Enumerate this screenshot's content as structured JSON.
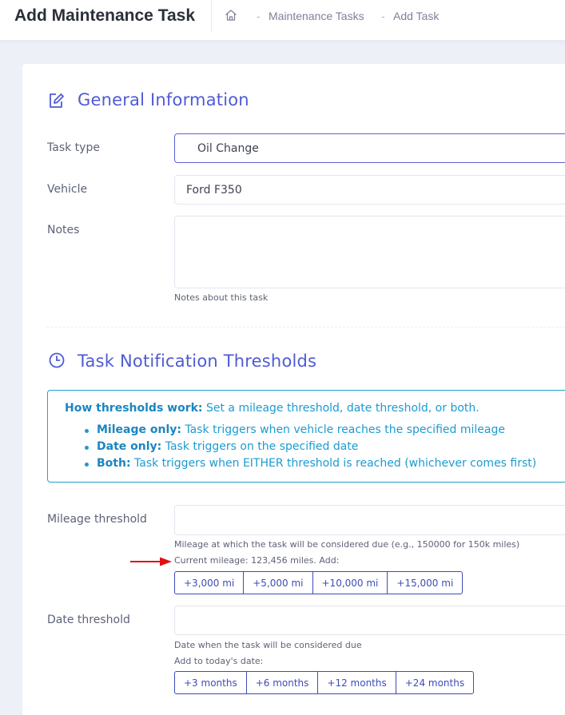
{
  "header": {
    "title": "Add Maintenance Task",
    "breadcrumb": [
      {
        "label": "Maintenance Tasks"
      },
      {
        "label": "Add Task"
      }
    ],
    "separator": "-"
  },
  "general": {
    "title": "General Information",
    "task_type": {
      "label": "Task type",
      "value": "Oil Change"
    },
    "vehicle": {
      "label": "Vehicle",
      "value": "Ford F350"
    },
    "notes": {
      "label": "Notes",
      "value": "",
      "help": "Notes about this task"
    }
  },
  "thresholds": {
    "title": "Task Notification Thresholds",
    "info": {
      "intro_bold": "How thresholds work:",
      "intro_text": "Set a mileage threshold, date threshold, or both.",
      "items": [
        {
          "bold": "Mileage only:",
          "text": "Task triggers when vehicle reaches the specified mileage"
        },
        {
          "bold": "Date only:",
          "text": "Task triggers on the specified date"
        },
        {
          "bold": "Both:",
          "text": "Task triggers when EITHER threshold is reached (whichever comes first)"
        }
      ]
    },
    "mileage": {
      "label": "Mileage threshold",
      "value": "",
      "help": "Mileage at which the task will be considered due (e.g., 150000 for 150k miles)",
      "current": "Current mileage: 123,456 miles. Add:",
      "buttons": [
        "+3,000 mi",
        "+5,000 mi",
        "+10,000 mi",
        "+15,000 mi"
      ]
    },
    "date": {
      "label": "Date threshold",
      "value": "",
      "help": "Date when the task will be considered due",
      "add_label": "Add to today's date:",
      "buttons": [
        "+3 months",
        "+6 months",
        "+12 months",
        "+24 months"
      ]
    }
  },
  "colors": {
    "accent": "#4f5bd5",
    "info": "#1c9bd0",
    "button_border": "#3d4db7",
    "arrow": "#e01010"
  }
}
